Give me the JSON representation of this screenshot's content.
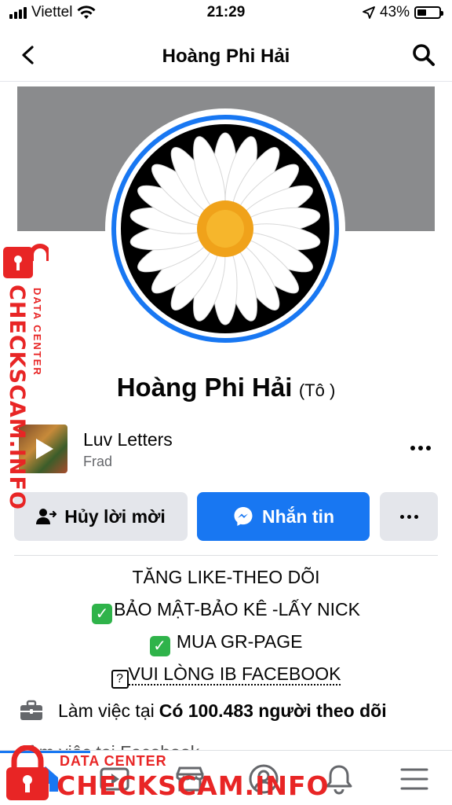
{
  "status_bar": {
    "carrier": "Viettel",
    "time": "21:29",
    "battery": "43%",
    "battery_level": 0.43
  },
  "nav": {
    "title": "Hoàng Phi Hải",
    "back_icon": "chevron-left-icon",
    "search_icon": "search-icon"
  },
  "profile": {
    "name": "Hoàng Phi Hải",
    "alt_name": "(Tô )"
  },
  "music": {
    "song": "Luv Letters",
    "artist": "Frad"
  },
  "actions": {
    "cancel_label": "Hủy lời mời",
    "message_label": "Nhắn tin"
  },
  "bio": {
    "line1": "TĂNG LIKE-THEO DÕI",
    "line2": "BẢO MẬT-BẢO KÊ -LẤY NICK",
    "line3": "MUA GR-PAGE",
    "line4_box": "?",
    "line4": "VUI LÒNG IB FACEBOOK"
  },
  "details": {
    "work_prefix": "Làm việc tại",
    "work_value": "Có 100.483 người theo dõi",
    "second_line": "Làm việc tại Facebook"
  },
  "watermark": {
    "small": "DATA CENTER",
    "big": "CHECKSCAM.INFO"
  },
  "colors": {
    "accent": "#1877f2",
    "watermark": "#e82525"
  }
}
